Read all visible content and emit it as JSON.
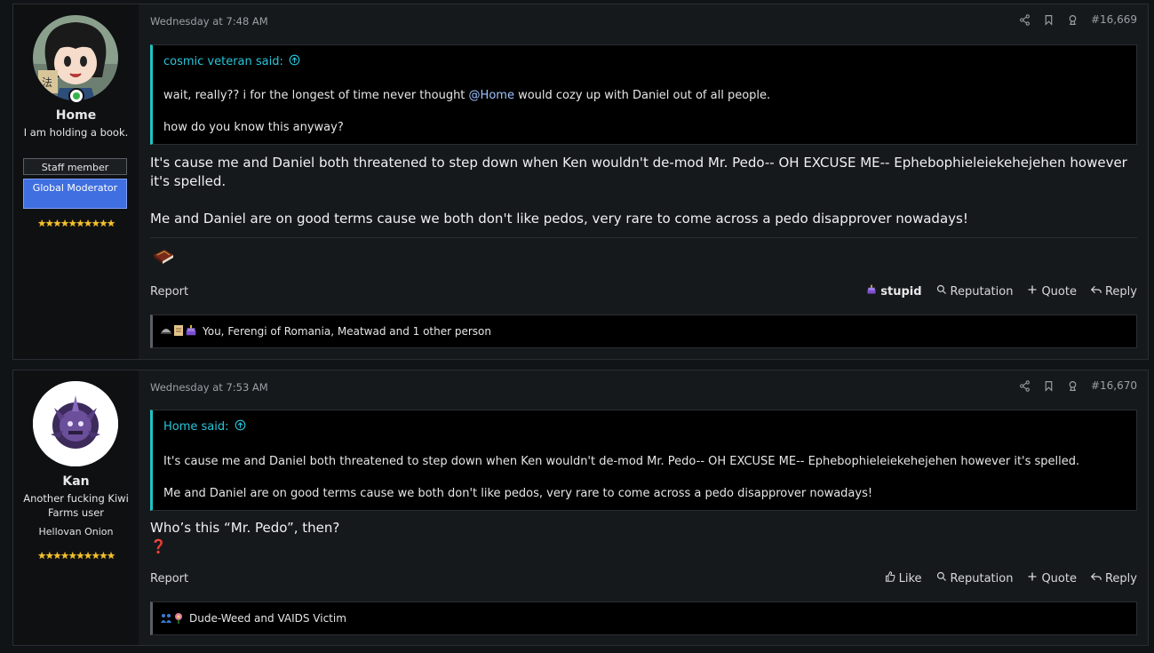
{
  "posts": [
    {
      "username": "Home",
      "title": "I am holding a book.",
      "banner_staff": "Staff member",
      "banner_mod": "Global Moderator",
      "stars": "★★★★★★★★★★",
      "date": "Wednesday at 7:48 AM",
      "post_number": "#16,669",
      "quote_author": "cosmic veteran said:",
      "quote_line1_pre": "wait, really?? i for the longest of time never thought ",
      "quote_mention": "@Home",
      "quote_line1_post": " would cozy up with Daniel out of all people.",
      "quote_line2": "how do you know this anyway?",
      "message_p1": "It's cause me and Daniel both threatened to step down when Ken wouldn't de-mod Mr. Pedo-- OH EXCUSE ME-- Ephebophieleiekehejehen however it's spelled.",
      "message_p2": "Me and Daniel are on good terms cause we both don't like pedos, very rare to come across a pedo disapprover nowadays!",
      "signature_icon": "book-emoji",
      "report": "Report",
      "reaction_label": "stupid",
      "reputation": "Reputation",
      "quote_action": "Quote",
      "reply": "Reply",
      "reactions_text": "You, Ferengi of Romania, Meatwad and 1 other person"
    },
    {
      "username": "Kan",
      "title": "Another fucking Kiwi Farms user",
      "extra": "Hellovan Onion",
      "stars": "★★★★★★★★★★",
      "date": "Wednesday at 7:53 AM",
      "post_number": "#16,670",
      "quote_author": "Home said:",
      "quote_line1": "It's cause me and Daniel both threatened to step down when Ken wouldn't de-mod Mr. Pedo-- OH EXCUSE ME-- Ephebophieleiekehejehen however it's spelled.",
      "quote_line2": "Me and Daniel are on good terms cause we both don't like pedos, very rare to come across a pedo disapprover nowadays!",
      "message_p1": "Who’s this “Mr. Pedo”, then?",
      "emoji": "❓",
      "report": "Report",
      "like": "Like",
      "reputation": "Reputation",
      "quote_action": "Quote",
      "reply": "Reply",
      "reactions_text": "Dude-Weed and VAIDS Victim"
    }
  ]
}
